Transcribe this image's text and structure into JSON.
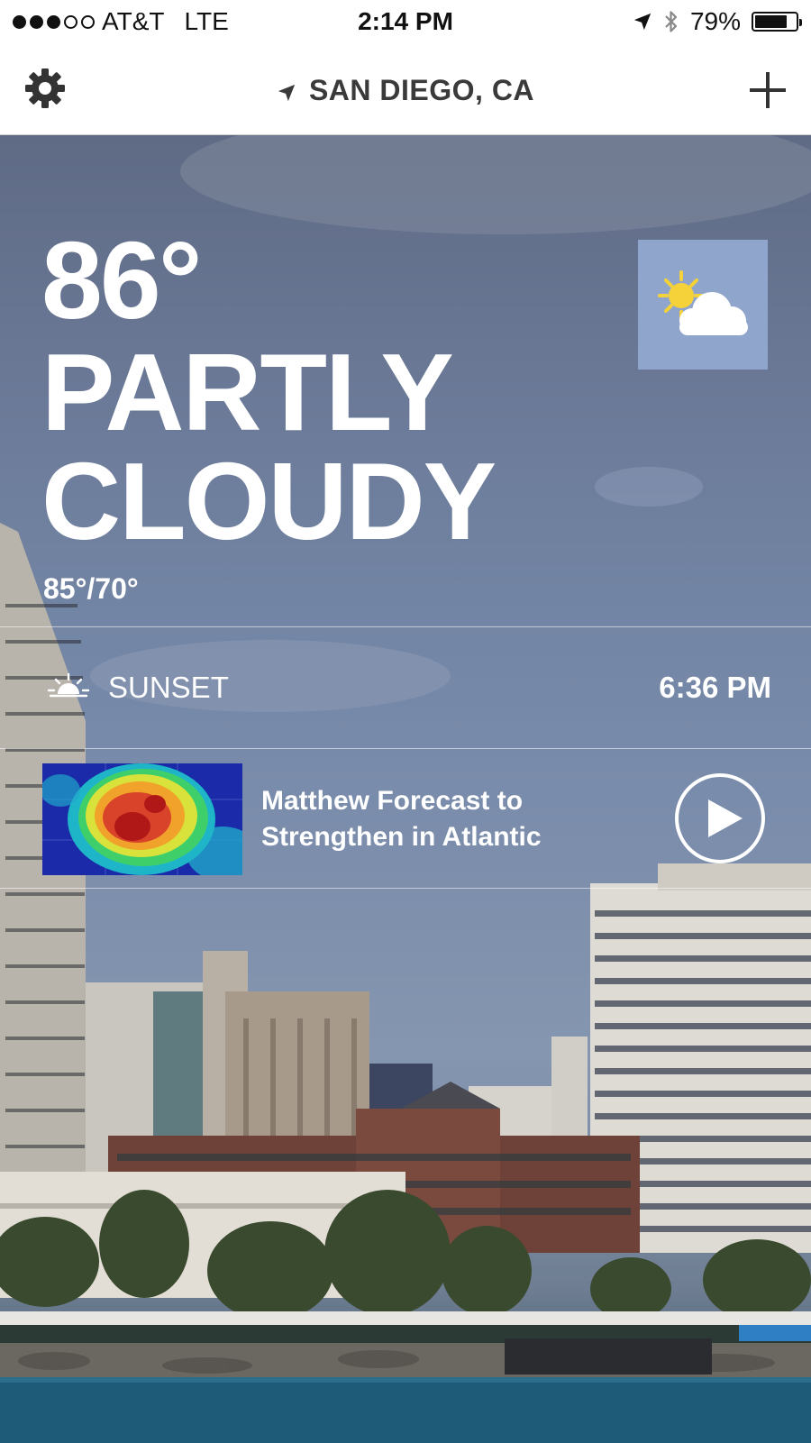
{
  "status_bar": {
    "signal_bars_full": 3,
    "signal_bars_total": 5,
    "carrier": "AT&T",
    "network": "LTE",
    "time": "2:14 PM",
    "battery_percent_label": "79%",
    "battery_level": 0.79,
    "icons": [
      "location-arrow-icon",
      "bluetooth-icon",
      "battery-icon"
    ]
  },
  "nav": {
    "location": "SAN DIEGO, CA",
    "left_icon": "gear-icon",
    "right_icon": "plus-icon"
  },
  "current": {
    "temperature": "86°",
    "condition_line1": "PARTLY",
    "condition_line2": "CLOUDY",
    "high_low": "85°/70°",
    "icon": "partly-cloudy-icon"
  },
  "sunset": {
    "label": "SUNSET",
    "time": "6:36 PM",
    "icon": "sunset-icon"
  },
  "news": {
    "headline": "Matthew Forecast to Strengthen in Atlantic",
    "thumbnail": "radar-thumbnail",
    "action_icon": "play-icon"
  },
  "colors": {
    "text": "#ffffff",
    "icon_box": "#8fa5cc",
    "sun": "#f5d23a",
    "nav_text": "#3a3a3a"
  }
}
